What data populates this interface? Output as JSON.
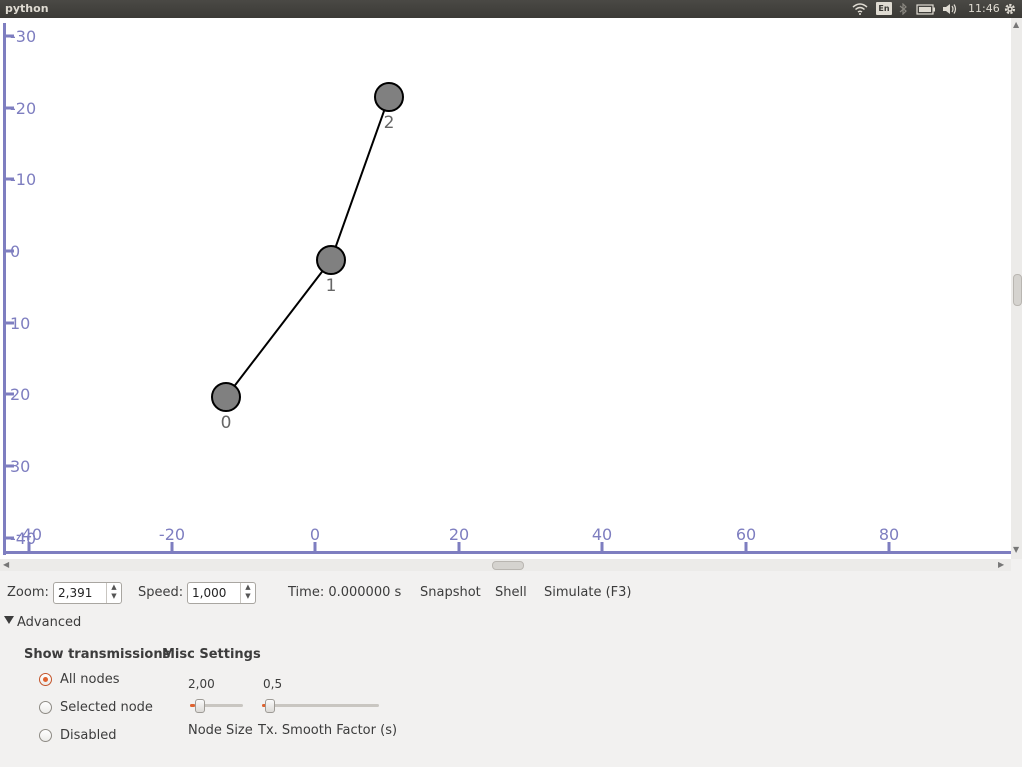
{
  "window": {
    "title": "python"
  },
  "panel": {
    "keyboard_layout": "En",
    "clock": "11:46"
  },
  "graph": {
    "x_ticks": [
      "-40",
      "-20",
      "0",
      "20",
      "40",
      "60",
      "80"
    ],
    "y_ticks": [
      "-30",
      "-20",
      "-10",
      "0",
      "10",
      "20",
      "30",
      "-40"
    ],
    "nodes": [
      {
        "label": "0"
      },
      {
        "label": "1"
      },
      {
        "label": "2"
      }
    ],
    "axis_color": "#7e7ec0",
    "node_fill": "#808080"
  },
  "controls": {
    "zoom_label": "Zoom:",
    "zoom_value": "2,391",
    "speed_label": "Speed:",
    "speed_value": "1,000",
    "time_text": "Time: 0.000000 s",
    "snapshot_label": "Snapshot",
    "shell_label": "Shell",
    "simulate_label": "Simulate (F3)"
  },
  "advanced": {
    "label": "Advanced",
    "show_transmissions": {
      "title": "Show transmissions",
      "options": [
        "All nodes",
        "Selected node",
        "Disabled"
      ],
      "selected": "All nodes"
    },
    "misc": {
      "title": "Misc Settings",
      "node_size": {
        "value": "2,00",
        "label": "Node Size",
        "level": 0.1
      },
      "smooth": {
        "value": "0,5",
        "label": "Tx. Smooth Factor (s)",
        "level": 0.05
      }
    }
  }
}
